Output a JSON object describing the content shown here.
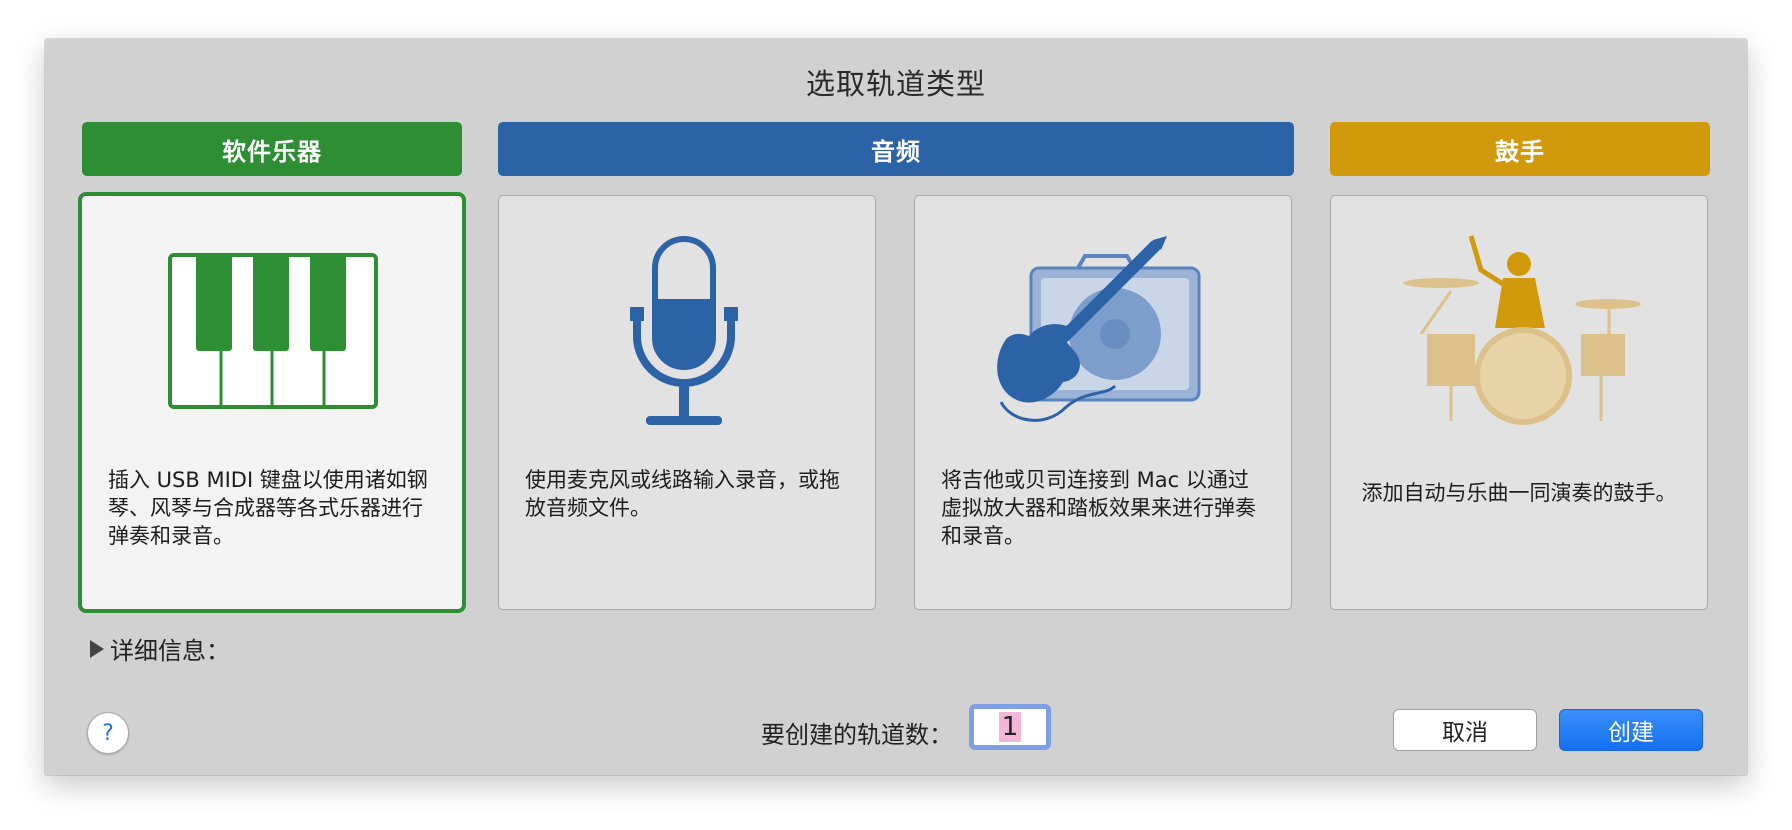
{
  "dialog": {
    "title": "选取轨道类型"
  },
  "categories": {
    "software": "软件乐器",
    "audio": "音频",
    "drummer": "鼓手"
  },
  "cards": {
    "software": "插入 USB MIDI 键盘以使用诸如钢琴、风琴与合成器等各式乐器进行弹奏和录音。",
    "microphone": "使用麦克风或线路输入录音，或拖放音频文件。",
    "guitar": "将吉他或贝司连接到 Mac 以通过虚拟放大器和踏板效果来进行弹奏和录音。",
    "drummer": "添加自动与乐曲一同演奏的鼓手。"
  },
  "details": {
    "label": "详细信息："
  },
  "footer": {
    "help": "?",
    "count_label": "要创建的轨道数：",
    "count_value": "1",
    "cancel": "取消",
    "create": "创建"
  },
  "colors": {
    "software": "#2d8e34",
    "audio": "#2c62a6",
    "drummer": "#d19a0c"
  },
  "icons": {
    "software": "piano-keyboard-icon",
    "microphone": "microphone-icon",
    "guitar": "guitar-amp-icon",
    "drummer": "drummer-icon",
    "details": "disclosure-triangle-icon",
    "help": "help-icon"
  }
}
